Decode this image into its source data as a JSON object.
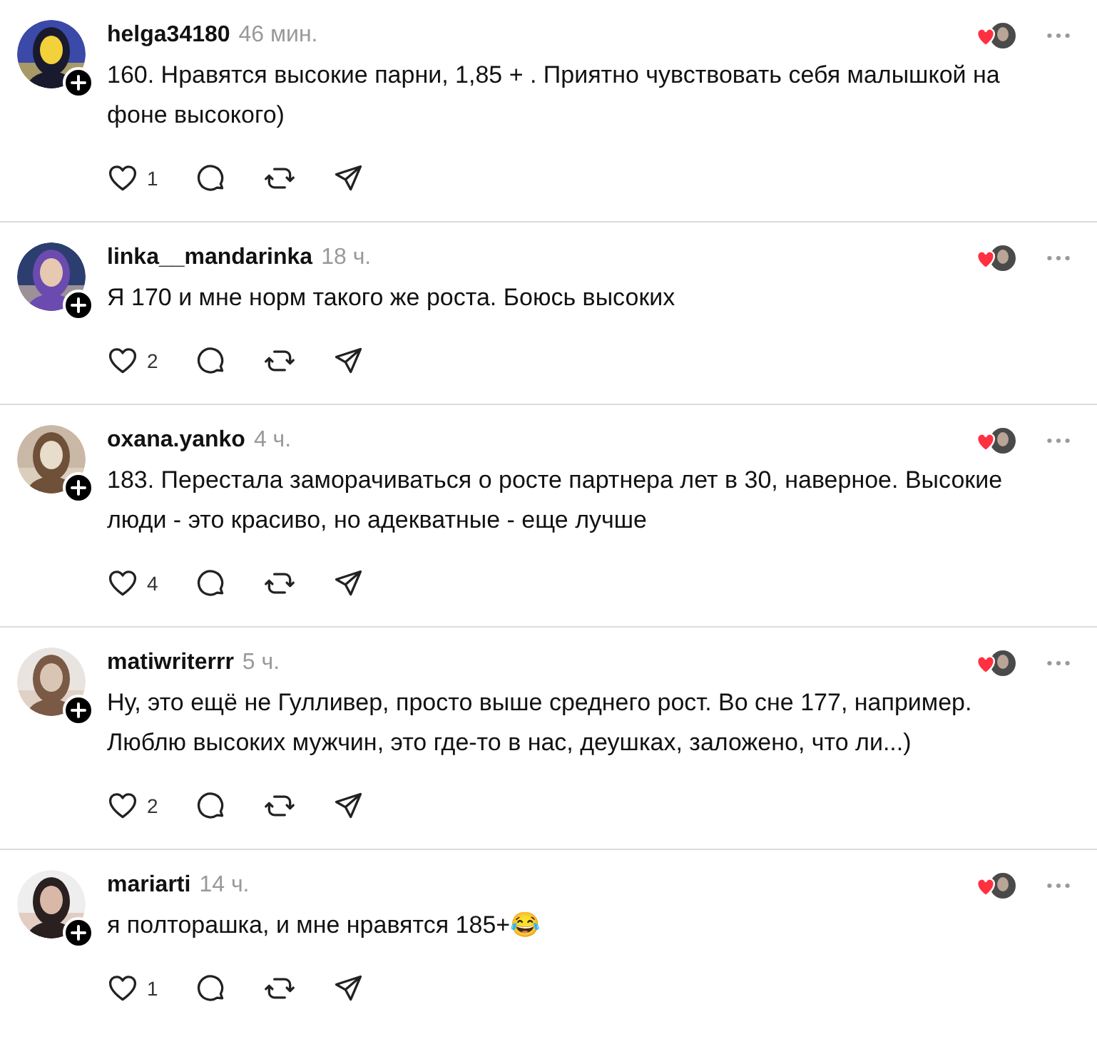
{
  "comments": [
    {
      "username": "helga34180",
      "time": "46 мин.",
      "text": "160. Нравятся высокие парни, 1,85 + . Приятно чувствовать себя малышкой на фоне высокого)",
      "likes": "1"
    },
    {
      "username": "linka__mandarinka",
      "time": "18 ч.",
      "text": "Я 170 и мне норм такого же роста. Боюсь высоких",
      "likes": "2"
    },
    {
      "username": "oxana.yanko",
      "time": "4 ч.",
      "text": "183. Перестала заморачиваться о росте партнера лет в 30, наверное. Высокие люди - это красиво, но адекватные - еще лучше",
      "likes": "4"
    },
    {
      "username": "matiwriterrr",
      "time": "5 ч.",
      "text": "Ну, это ещё не Гулливер, просто выше среднего рост. Во сне 177, например. Люблю высоких мужчин, это где-то в нас, деушках, заложено, что ли...)",
      "likes": "2"
    },
    {
      "username": "mariarti",
      "time": "14 ч.",
      "text": "я полторашка, и мне нравятся 185+😂",
      "likes": "1"
    }
  ]
}
